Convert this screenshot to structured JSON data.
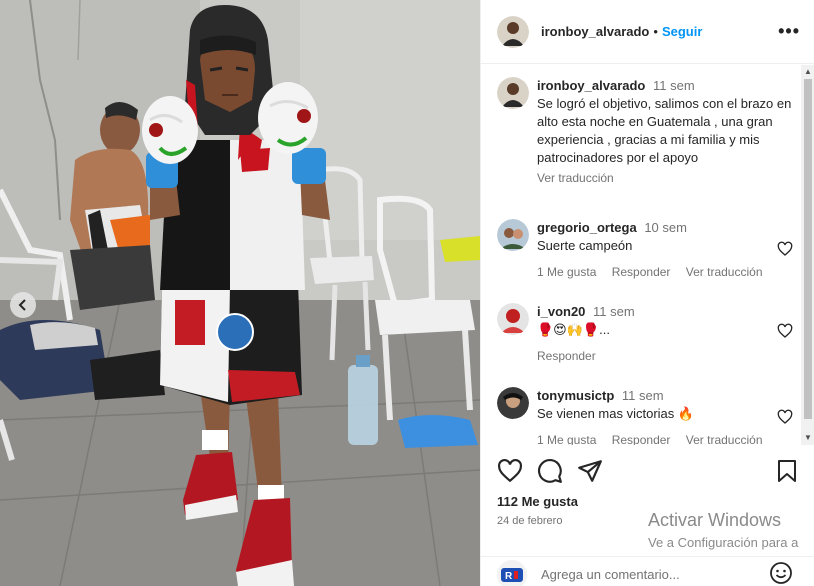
{
  "post": {
    "author": "ironboy_alvarado",
    "separator": "•",
    "follow_label": "Seguir",
    "more_label": "•••",
    "caption": {
      "username": "ironboy_alvarado",
      "time": "11 sem",
      "text": "Se logró el objetivo, salimos con el brazo en alto esta noche en Guatemala , una gran experiencia , gracias a mi familia y mis patrocinadores por el apoyo",
      "translate_label": "Ver traducción"
    },
    "comments": [
      {
        "username": "gregorio_ortega",
        "time": "10 sem",
        "text": "Suerte campeón",
        "likes_label": "1 Me gusta",
        "reply_label": "Responder",
        "translate_label": "Ver traducción"
      },
      {
        "username": "i_von20",
        "time": "11 sem",
        "text": "🥊😍🙌🥊...",
        "reply_label": "Responder"
      },
      {
        "username": "tonymusictp",
        "time": "11 sem",
        "text": "Se vienen mas victorias 🔥",
        "likes_label": "1 Me gusta",
        "reply_label": "Responder",
        "translate_label": "Ver traducción"
      }
    ],
    "likes": "112 Me gusta",
    "date": "24 de febrero",
    "comment_placeholder": "Agrega un comentario...",
    "icons": {
      "like": "heart-icon",
      "comment": "comment-icon",
      "share": "share-icon",
      "save": "bookmark-icon",
      "emoji": "emoji-icon",
      "prev": "chevron-left-icon"
    }
  },
  "watermark": {
    "line1": "Activar Windows",
    "line2": "Ve a Configuración para a"
  },
  "colors": {
    "accent": "#0095f6",
    "text": "#262626",
    "secondary": "#737373"
  }
}
